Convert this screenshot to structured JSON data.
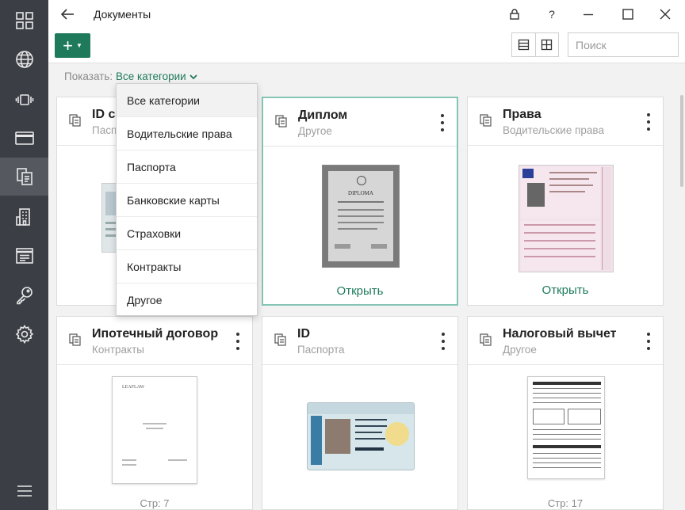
{
  "window": {
    "title": "Документы"
  },
  "toolbar": {
    "search_placeholder": "Поиск"
  },
  "filter": {
    "label": "Показать:",
    "value": "Все категории",
    "options": [
      "Все категории",
      "Водительские права",
      "Паспорта",
      "Банковские карты",
      "Страховки",
      "Контракты",
      "Другое"
    ]
  },
  "cards": [
    {
      "title": "ID card",
      "subtitle": "Паспорта"
    },
    {
      "title": "Диплом",
      "subtitle": "Другое",
      "action": "Открыть",
      "selected": true
    },
    {
      "title": "Права",
      "subtitle": "Водительские права",
      "action": "Открыть"
    },
    {
      "title": "Ипотечный договор",
      "subtitle": "Контракты",
      "pages": "Стр: 7"
    },
    {
      "title": "ID",
      "subtitle": "Паспорта"
    },
    {
      "title": "Налоговый вычет",
      "subtitle": "Другое",
      "pages": "Стр: 17"
    }
  ],
  "thumbnails": {
    "diploma_heading": "DIPLOMA",
    "contract_logo": "LEAFLAW"
  },
  "sidebar": {
    "items": [
      "dashboard-icon",
      "globe-icon",
      "vibrate-icon",
      "card-icon",
      "documents-icon",
      "building-icon",
      "notes-icon",
      "key-icon",
      "settings-icon",
      "menu-icon"
    ]
  },
  "colors": {
    "accent": "#1e7a5b",
    "sidebar": "#3b3f45",
    "selected_border": "#86c5b5"
  }
}
